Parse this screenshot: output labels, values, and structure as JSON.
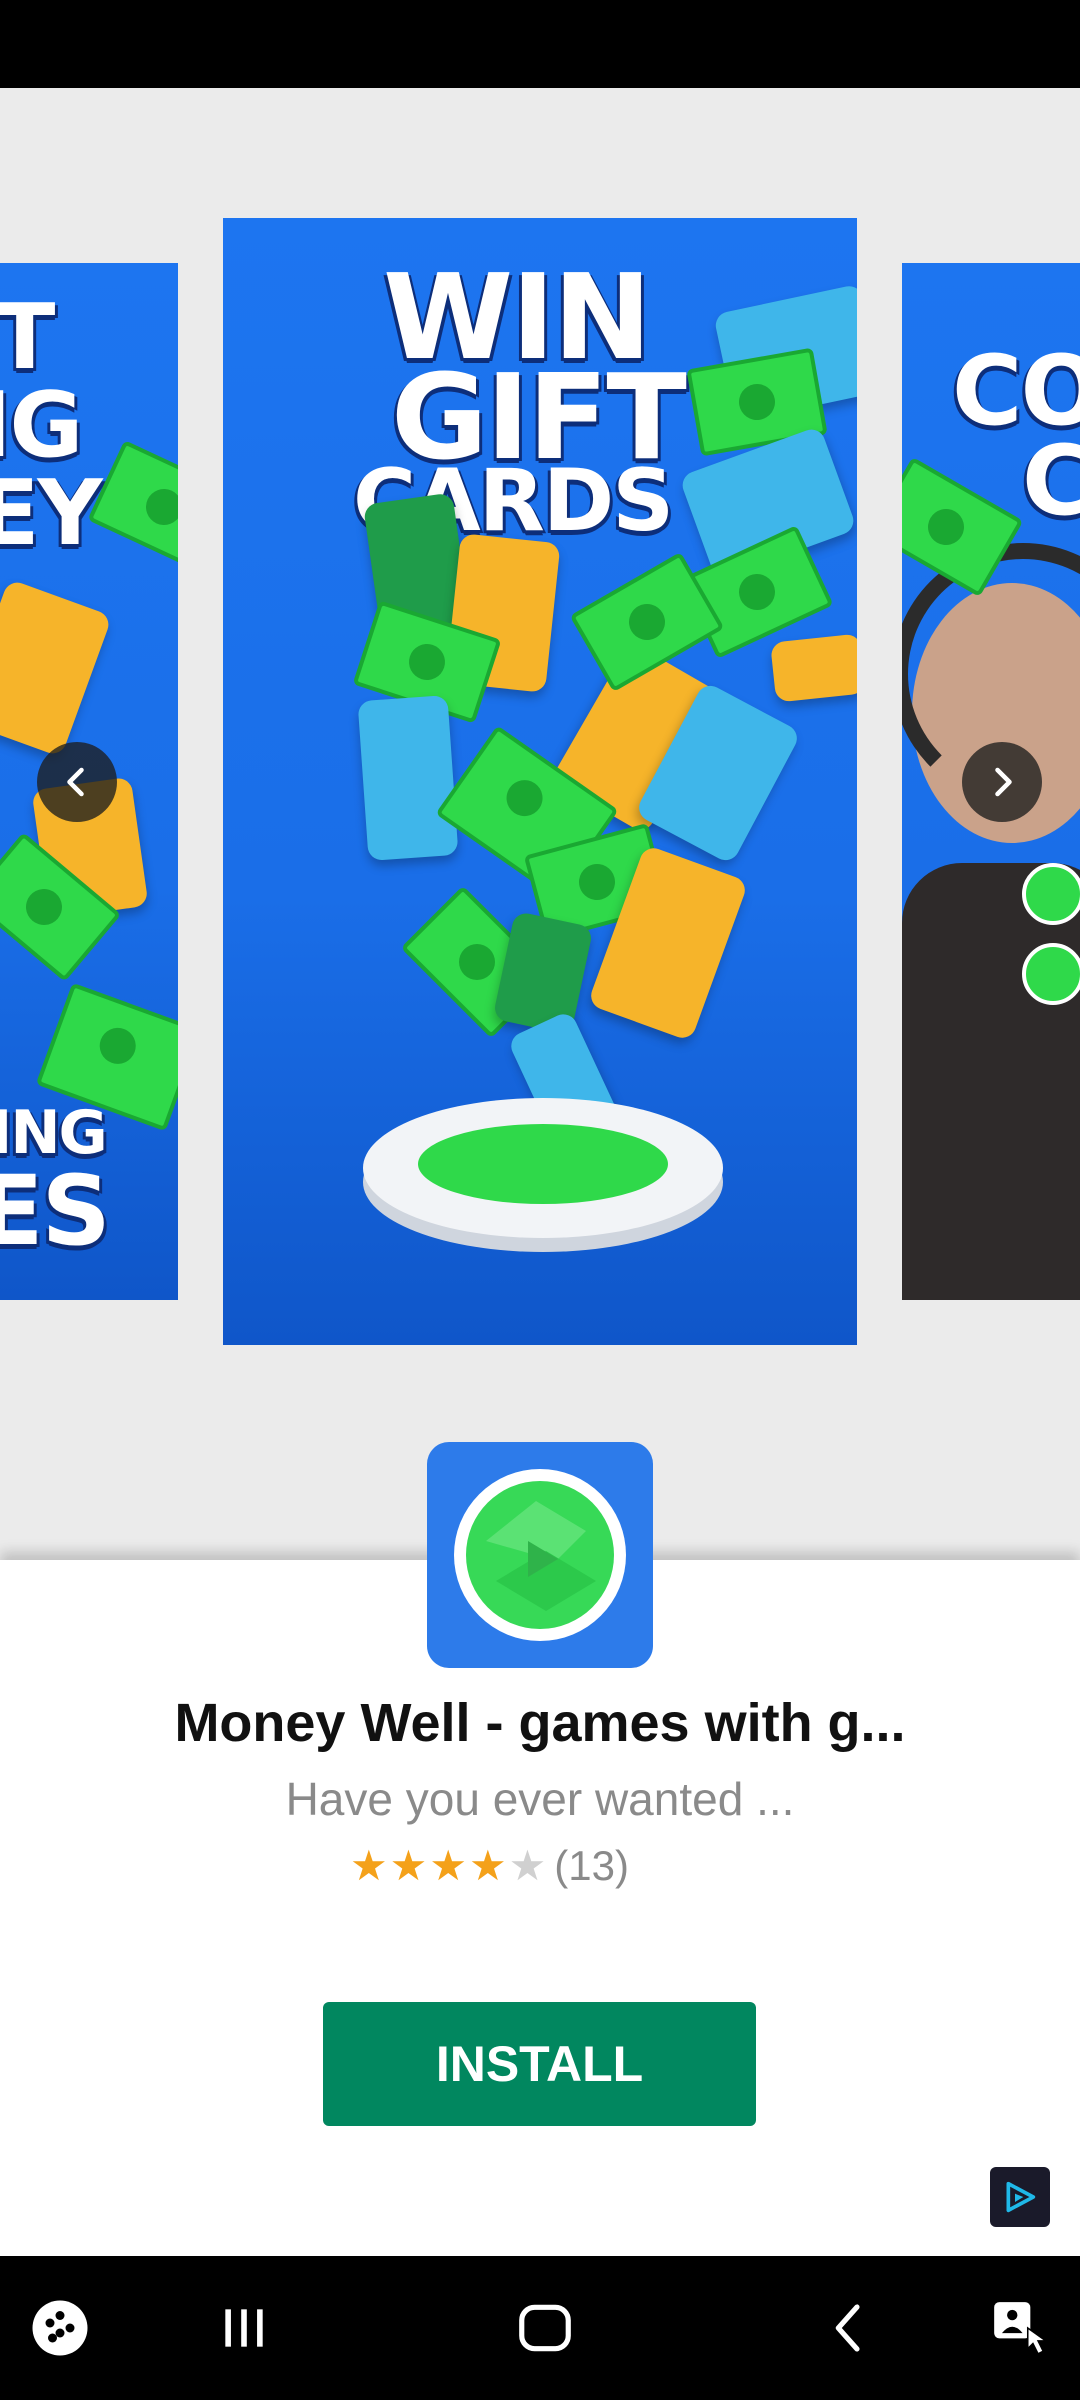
{
  "carousel": {
    "left_text_lines": [
      "T",
      "IG",
      "EY",
      "ING",
      "ES"
    ],
    "main_headline": [
      "WIN",
      "GIFT",
      "CARDS"
    ],
    "right_text_lines": [
      "CO",
      "C"
    ]
  },
  "app": {
    "title": "Money Well - games with g...",
    "description": "Have you ever wanted ...",
    "rating": 4,
    "rating_max": 5,
    "rating_count": "(13)",
    "install_label": "INSTALL"
  },
  "colors": {
    "install_green": "#01875f",
    "star_gold": "#f4a11a",
    "star_empty": "#d0d0d0",
    "icon_blue": "#2d7bea"
  },
  "icons": {
    "carousel_prev": "chevron-left-icon",
    "carousel_next": "chevron-right-icon",
    "ad_choices": "play-triangle-icon",
    "nav": [
      "game-launcher-icon",
      "recents-icon",
      "home-icon",
      "back-icon",
      "accessibility-icon"
    ]
  }
}
